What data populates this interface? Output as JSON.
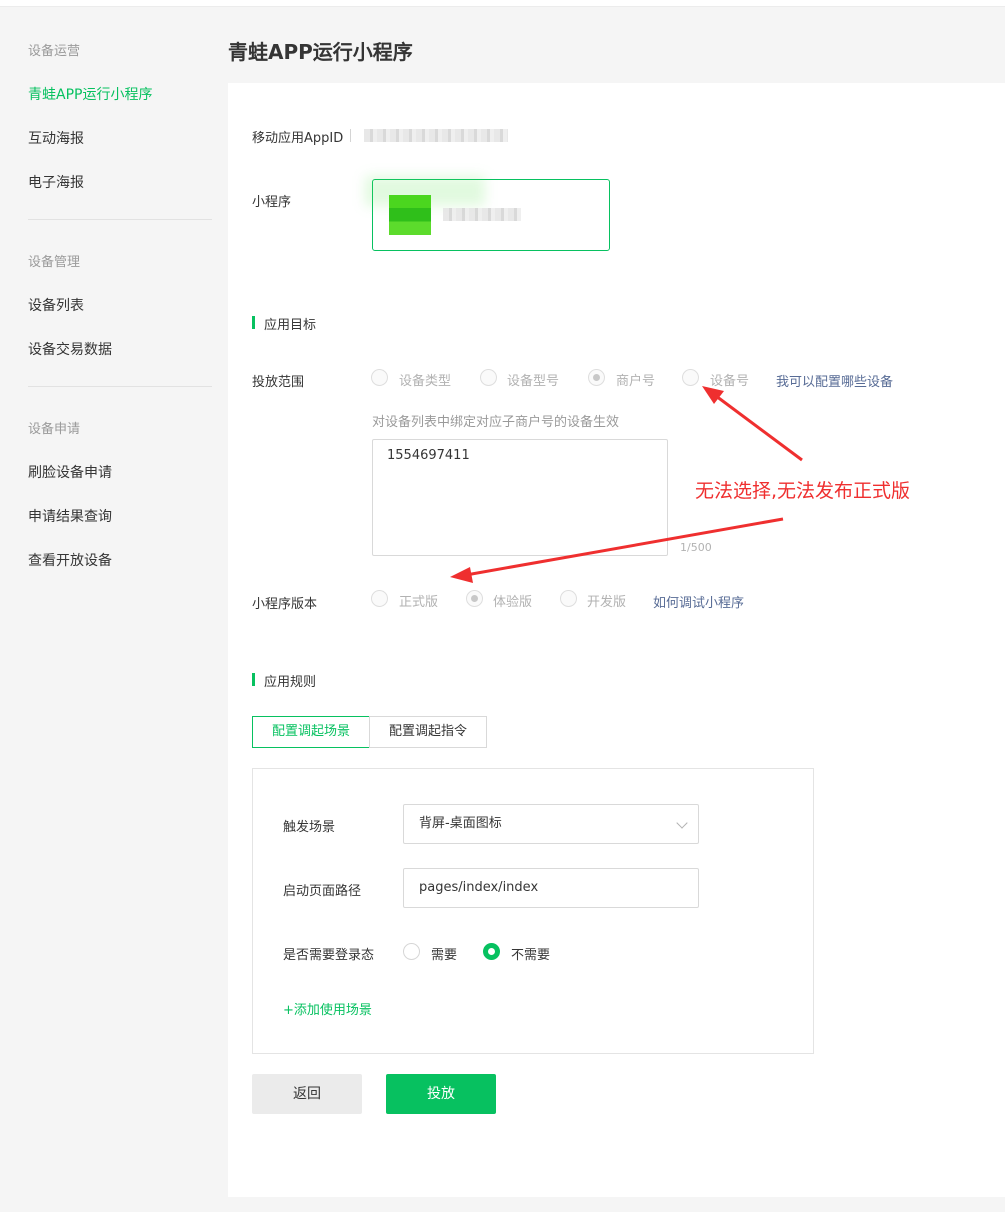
{
  "sidebar": {
    "groups": [
      {
        "title": "设备运营",
        "items": [
          {
            "label": "青蛙APP运行小程序",
            "active": true
          },
          {
            "label": "互动海报"
          },
          {
            "label": "电子海报"
          }
        ]
      },
      {
        "title": "设备管理",
        "items": [
          {
            "label": "设备列表"
          },
          {
            "label": "设备交易数据"
          }
        ]
      },
      {
        "title": "设备申请",
        "items": [
          {
            "label": "刷脸设备申请"
          },
          {
            "label": "申请结果查询"
          },
          {
            "label": "查看开放设备"
          }
        ]
      }
    ]
  },
  "page": {
    "title": "青蛙APP运行小程序"
  },
  "form": {
    "appid_label": "移动应用AppID",
    "miniprogram_label": "小程序",
    "target_section": "应用目标",
    "scope_label": "投放范围",
    "scope_options": [
      "设备类型",
      "设备型号",
      "商户号",
      "设备号"
    ],
    "scope_selected": "商户号",
    "scope_help_link": "我可以配置哪些设备",
    "scope_hint": "对设备列表中绑定对应子商户号的设备生效",
    "merchant_ids": "1554697411",
    "counter": "1/500",
    "version_label": "小程序版本",
    "version_options": [
      "正式版",
      "体验版",
      "开发版"
    ],
    "version_selected": "体验版",
    "version_help_link": "如何调试小程序",
    "rules_section": "应用规则",
    "tabs": [
      "配置调起场景",
      "配置调起指令"
    ],
    "active_tab": "配置调起场景",
    "trigger_label": "触发场景",
    "trigger_value": "背屏-桌面图标",
    "path_label": "启动页面路径",
    "path_value": "pages/index/index",
    "login_label": "是否需要登录态",
    "login_options": [
      "需要",
      "不需要"
    ],
    "login_selected": "不需要",
    "add_scene": "+添加使用场景",
    "back_button": "返回",
    "submit_button": "投放"
  },
  "annotation": {
    "text": "无法选择,无法发布正式版",
    "color": "#ef2f2f"
  },
  "colors": {
    "accent": "#07c160",
    "link": "#576b95",
    "annotation": "#ef2f2f"
  }
}
